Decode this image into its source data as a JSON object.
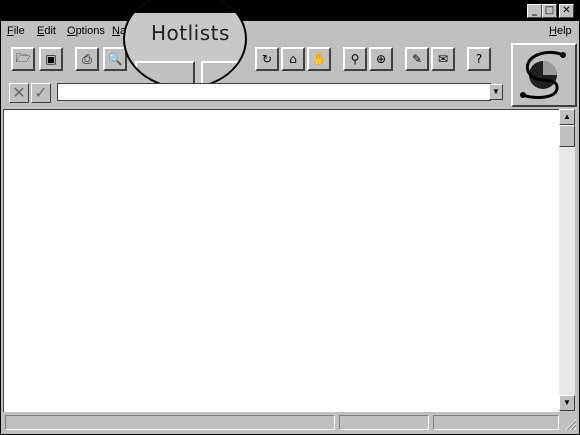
{
  "window": {
    "minimize_glyph": "_",
    "maximize_glyph": "□",
    "close_glyph": "✕"
  },
  "menu": {
    "file": "File",
    "file_rest": "ile",
    "file_key": "F",
    "edit": "Edit",
    "edit_key": "E",
    "edit_rest": "dit",
    "options": "Options",
    "options_key": "O",
    "options_rest": "ptions",
    "nav_partial": "Na",
    "nav_key": "N",
    "nav_rest": "a",
    "help": "Help",
    "help_key": "H",
    "help_rest": "elp"
  },
  "magnified_label": "Hotlists",
  "toolbar_icons": [
    "open-folder-icon",
    "save-disk-icon",
    "print-icon",
    "print-preview-icon",
    "stop-icon",
    "reload-icon",
    "home-icon",
    "hand-icon",
    "find-icon",
    "add-bookmark-icon",
    "edit-icon",
    "mail-icon",
    "help-icon"
  ],
  "url": {
    "value": "",
    "cancel_glyph": "✕",
    "confirm_glyph": "✓",
    "dropdown_glyph": "▼"
  },
  "scroll": {
    "up_glyph": "▲",
    "down_glyph": "▼"
  },
  "icons": {
    "open": "🗁",
    "save": "▣",
    "print": "⎙",
    "preview": "🔍",
    "reload": "↻",
    "home": "⌂",
    "hand": "✋",
    "find": "⚲",
    "addmark": "⊕",
    "edit": "✎",
    "mail": "✉",
    "help": "?"
  }
}
